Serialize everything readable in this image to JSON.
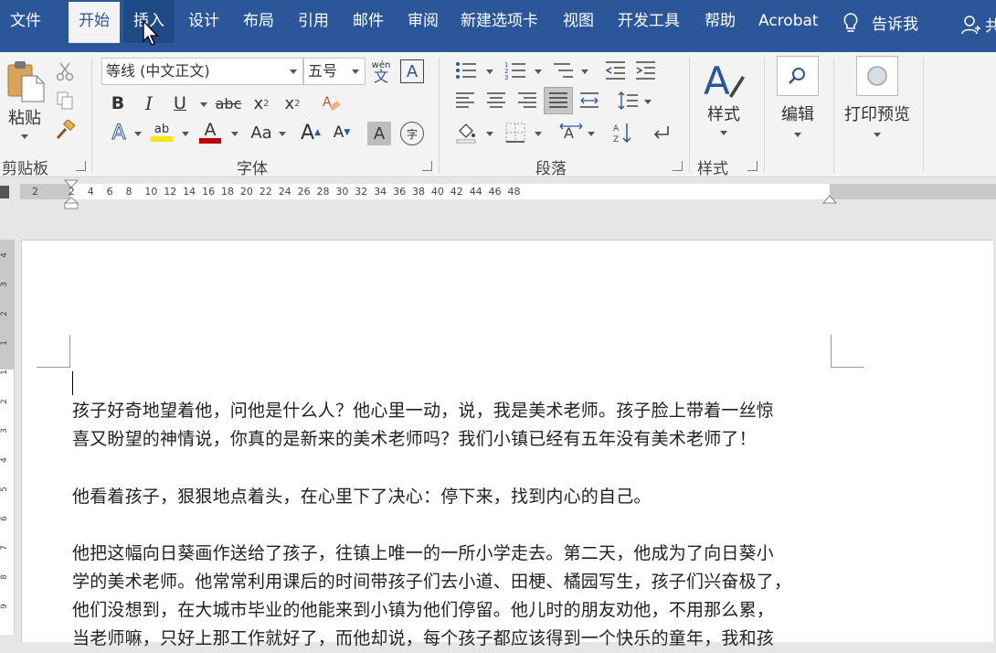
{
  "tabs": [
    {
      "label": "文件"
    },
    {
      "label": "开始"
    },
    {
      "label": "插入"
    },
    {
      "label": "设计"
    },
    {
      "label": "布局"
    },
    {
      "label": "引用"
    },
    {
      "label": "邮件"
    },
    {
      "label": "审阅"
    },
    {
      "label": "新建选项卡"
    },
    {
      "label": "视图"
    },
    {
      "label": "开发工具"
    },
    {
      "label": "帮助"
    },
    {
      "label": "Acrobat"
    }
  ],
  "tellme": {
    "label": "告诉我"
  },
  "share": {
    "label": "共"
  },
  "clipboard": {
    "paste_label": "粘贴",
    "group_label": "剪贴板"
  },
  "font": {
    "family_value": "等线 (中文正文)",
    "size_value": "五号",
    "group_label": "字体",
    "phonetic_top": "wén",
    "phonetic_bottom": "文",
    "border_char": "A",
    "bold": "B",
    "italic": "I",
    "underline": "U",
    "strike": "abc",
    "subscript": "x",
    "subscript_small": "2",
    "superscript": "x",
    "superscript_small": "2",
    "effects": "A",
    "highlight": "ab",
    "color": "A",
    "case": "Aa",
    "grow": "A",
    "shrink": "A",
    "shade": "A",
    "enclose": "字"
  },
  "paragraph": {
    "group_label": "段落"
  },
  "styles": {
    "label": "样式",
    "group_label": "样式"
  },
  "editing": {
    "label": "编辑"
  },
  "print_preview": {
    "label": "打印预览"
  },
  "ruler": {
    "numbers": [
      "2",
      "2",
      "4",
      "6",
      "8",
      "10",
      "12",
      "14",
      "16",
      "18",
      "20",
      "22",
      "24",
      "26",
      "28",
      "30",
      "32",
      "34",
      "36",
      "38",
      "40",
      "42",
      "44",
      "46",
      "48"
    ]
  },
  "vruler": {
    "numbers": [
      "4",
      "3",
      "2",
      "1",
      "1",
      "2",
      "3",
      "4",
      "5",
      "6",
      "7",
      "8",
      "9"
    ]
  },
  "document": {
    "paragraphs": [
      {
        "line1": "孩子好奇地望着他，问他是什么人？他心里一动，说，我是美术老师。孩子脸上带着一丝惊",
        "line2": "喜又盼望的神情说，你真的是新来的美术老师吗？我们小镇已经有五年没有美术老师了！"
      },
      {
        "line1": "他看着孩子，狠狠地点着头，在心里下了决心：停下来，找到内心的自己。"
      },
      {
        "line1": "他把这幅向日葵画作送给了孩子，往镇上唯一的一所小学走去。第二天，他成为了向日葵小",
        "line2": "学的美术老师。他常常利用课后的时间带孩子们去小道、田梗、橘园写生，孩子们兴奋极了，",
        "line3": "他们没想到，在大城市毕业的他能来到小镇为他们停留。他儿时的朋友劝他，不用那么累，",
        "line4": "当老师嘛，只好上那工作就好了，而他却说，每个孩子都应该得到一个快乐的童年，我和孩"
      }
    ]
  },
  "colors": {
    "brand": "#2b579a",
    "highlight": "#ffe600",
    "font_color": "#c00000"
  }
}
